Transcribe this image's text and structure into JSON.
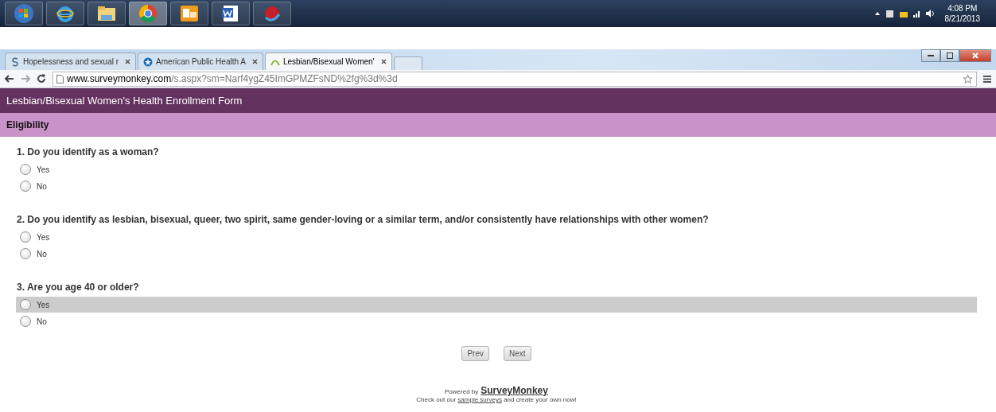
{
  "taskbar": {
    "apps": [
      {
        "kind": "start"
      },
      {
        "kind": "ie"
      },
      {
        "kind": "folder"
      },
      {
        "kind": "chrome",
        "selected": true
      },
      {
        "kind": "outlook"
      },
      {
        "kind": "word"
      },
      {
        "kind": "lang"
      }
    ],
    "time": "4:08 PM",
    "date": "8/21/2013"
  },
  "browser": {
    "tabs": [
      {
        "title": "Hopelessness and sexual r",
        "selected": false,
        "kind": "s"
      },
      {
        "title": "American Public Health A",
        "selected": false,
        "kind": "globe"
      },
      {
        "title": "Lesbian/Bisexual Women'",
        "selected": true,
        "kind": "monkey"
      }
    ],
    "url_host": "www.surveymonkey.com",
    "url_path": "/s.aspx?sm=Narf4ygZ45ImGPMZFsND%2fg%3d%3d"
  },
  "survey": {
    "title": "Lesbian/Bisexual Women's Health Enrollment Form",
    "section": "Eligibility",
    "questions": [
      {
        "text": "1. Do you identify as a woman?",
        "options": [
          {
            "label": "Yes",
            "selected": false,
            "highlighted": false
          },
          {
            "label": "No",
            "selected": false,
            "highlighted": false
          }
        ]
      },
      {
        "text": "2. Do you identify as lesbian, bisexual, queer, two spirit, same gender-loving or a similar term, and/or consistently have relationships with other women?",
        "options": [
          {
            "label": "Yes",
            "selected": false,
            "highlighted": false
          },
          {
            "label": "No",
            "selected": false,
            "highlighted": false
          }
        ]
      },
      {
        "text": "3. Are you age 40 or older?",
        "options": [
          {
            "label": "Yes",
            "selected": false,
            "highlighted": true
          },
          {
            "label": "No",
            "selected": false,
            "highlighted": false
          }
        ]
      }
    ],
    "buttons": [
      "Prev",
      "Next"
    ]
  },
  "footer": {
    "powered": "Powered by",
    "brand": "SurveyMonkey",
    "before": "Check out our",
    "link": "sample surveys",
    "after": "and create your own now!"
  }
}
